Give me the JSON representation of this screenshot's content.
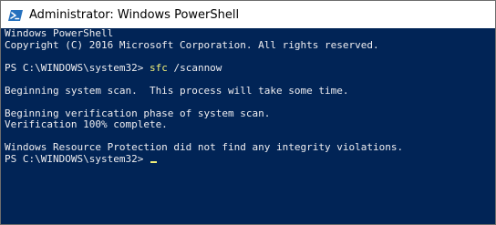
{
  "window": {
    "title": "Administrator: Windows PowerShell",
    "icon": "powershell-icon"
  },
  "console": {
    "header_line_1": "Windows PowerShell",
    "header_line_2": "Copyright (C) 2016 Microsoft Corporation. All rights reserved.",
    "prompt_1": "PS C:\\WINDOWS\\system32> ",
    "command_1": "sfc",
    "command_1_args": " /scannow",
    "output_1": "Beginning system scan.  This process will take some time.",
    "output_2": "Beginning verification phase of system scan.",
    "output_3": "Verification 100% complete.",
    "output_4": "Windows Resource Protection did not find any integrity violations.",
    "prompt_2": "PS C:\\WINDOWS\\system32> "
  },
  "colors": {
    "console_background": "#012456",
    "console_text": "#eeedf0",
    "command_text": "#f3f179"
  }
}
